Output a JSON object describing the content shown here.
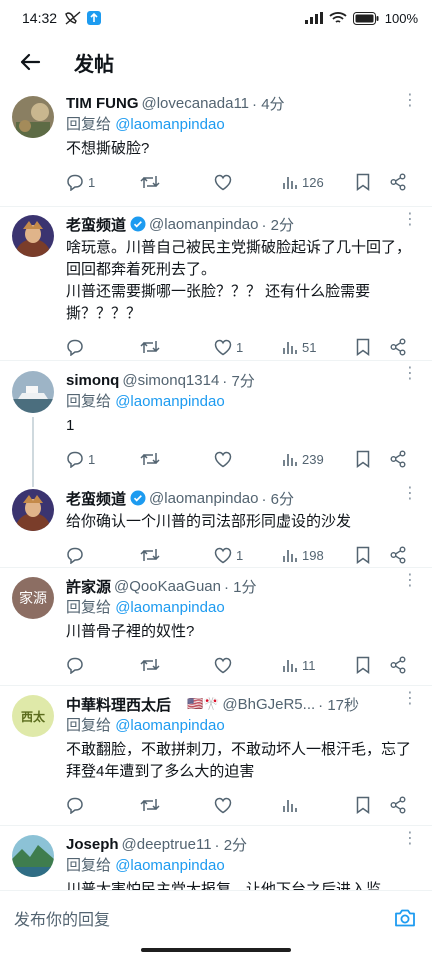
{
  "status_bar": {
    "time": "14:32",
    "battery": "100%"
  },
  "header": {
    "title": "发帖"
  },
  "reply_prefix": "回复给",
  "tweets": [
    {
      "author": "TIM FUNG",
      "handle": "@lovecanada11",
      "time": "· 4分",
      "reply_to": "@laomanpindao",
      "text": "不想撕破脸?",
      "replies": "1",
      "retweets": "",
      "likes": "",
      "views": "126"
    },
    {
      "author": "老蛮频道",
      "handle": "@laomanpindao",
      "time": "· 2分",
      "verified": true,
      "text": "啥玩意。川普自己被民主党撕破脸起诉了几十回了，回回都奔着死刑去了。\n川普还需要撕哪一张脸？？？ 还有什么脸需要撕？？？？",
      "replies": "",
      "retweets": "",
      "likes": "1",
      "views": "51"
    },
    {
      "author": "simonq",
      "handle": "@simonq1314",
      "time": "· 7分",
      "reply_to": "@laomanpindao",
      "text": "1",
      "replies": "1",
      "retweets": "",
      "likes": "",
      "views": "239"
    },
    {
      "author": "老蛮频道",
      "handle": "@laomanpindao",
      "time": "· 6分",
      "verified": true,
      "text": "给你确认一个川普的司法部形同虚设的沙发",
      "replies": "",
      "retweets": "",
      "likes": "1",
      "views": "198"
    },
    {
      "author": "許家源",
      "handle": "@QooKaaGuan",
      "time": "· 1分",
      "reply_to": "@laomanpindao",
      "avatar_text": "家源",
      "text": "川普骨子裡的奴性?",
      "replies": "",
      "retweets": "",
      "likes": "",
      "views": "11"
    },
    {
      "author": "中華料理西太后",
      "flags": "🇺🇸🎌",
      "handle": "@BhGJeR5...",
      "time": "· 17秒",
      "reply_to": "@laomanpindao",
      "avatar_text": "西太",
      "text": "不敢翻脸，不敢拼刺刀，不敢动坏人一根汗毛，忘了拜登4年遭到了多么大的迫害",
      "replies": "",
      "retweets": "",
      "likes": "",
      "views": ""
    },
    {
      "author": "Joseph",
      "handle": "@deeptrue11",
      "time": "· 2分",
      "reply_to": "@laomanpindao",
      "text": "川普太害怕民主党大报复，让他下台之后进入监"
    }
  ],
  "reply_bar": {
    "placeholder": "发布你的回复"
  },
  "colors": {
    "accent": "#1d9bf0",
    "text": "#0f1419",
    "secondary": "#536471",
    "divider": "#eff3f4"
  }
}
